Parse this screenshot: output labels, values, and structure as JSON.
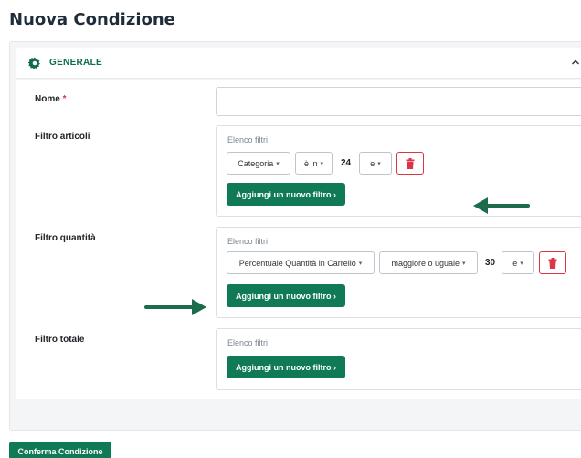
{
  "page": {
    "title": "Nuova Condizione"
  },
  "section": {
    "title": "GENERALE",
    "icon": "gear-icon",
    "toggle_icon": "chevron-up-icon"
  },
  "form": {
    "name": {
      "label": "Nome",
      "required_mark": "*",
      "value": ""
    },
    "article_filter": {
      "label": "Filtro articoli",
      "list_title": "Elenco filtri",
      "row": {
        "field": "Categoria",
        "operator": "è in",
        "value": "24",
        "connector": "e"
      },
      "add_label": "Aggiungi un nuovo filtro ›"
    },
    "quantity_filter": {
      "label": "Filtro quantità",
      "list_title": "Elenco filtri",
      "row": {
        "field": "Percentuale Quantità in Carrello",
        "operator": "maggiore o uguale",
        "value": "30",
        "connector": "e"
      },
      "add_label": "Aggiungi un nuovo filtro ›"
    },
    "total_filter": {
      "label": "Filtro totale",
      "list_title": "Elenco filtri",
      "add_label": "Aggiungi un nuovo filtro ›"
    }
  },
  "actions": {
    "confirm_label": "Conferma Condizione"
  },
  "colors": {
    "primary": "#0f7a55",
    "danger": "#dc3545",
    "arrow": "#1c6b4d"
  }
}
